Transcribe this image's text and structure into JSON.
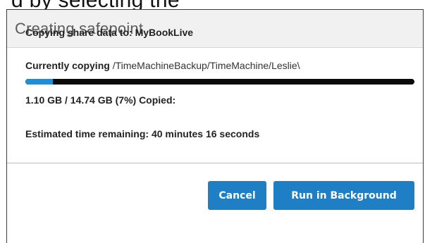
{
  "cropped_text": "d by selecting the",
  "dialog": {
    "title": "Creating safepoint",
    "copy_destination_label": "Copying share data to:",
    "copy_destination_value": "MyBookLive",
    "currently_copying_label": "Currently copying",
    "currently_copying_path": "/TimeMachineBackup/TimeMachine/Leslie\\",
    "progress": {
      "fraction": 0.07,
      "fill_color": "#1f8ed6",
      "track_color": "#0a0a0a"
    },
    "copied_text": "1.10 GB  /  14.74 GB (7%)  Copied:",
    "estimated_label": "Estimated time remaining:",
    "estimated_value": "40 minutes 16 seconds"
  },
  "buttons": {
    "cancel_label": "Cancel",
    "run_background_label": "Run in Background",
    "color": "#1f7fc4"
  }
}
